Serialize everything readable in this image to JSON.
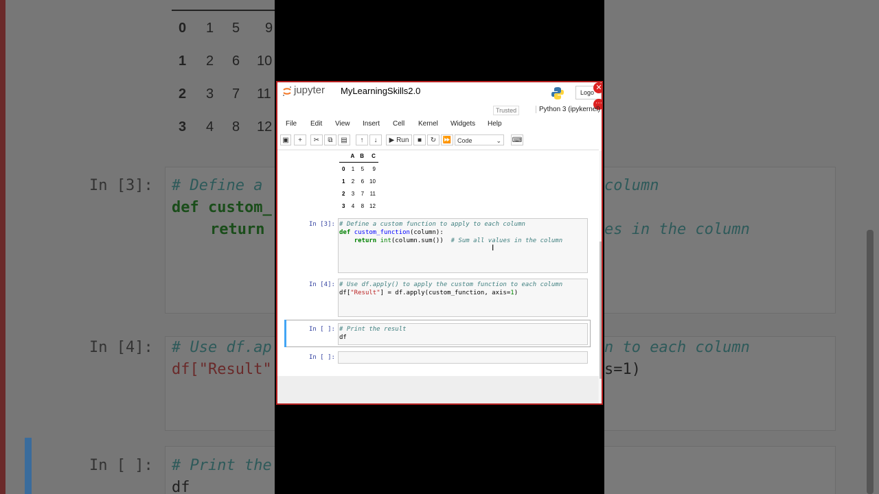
{
  "background": {
    "table_rows": [
      [
        "0",
        "1",
        "5",
        "9"
      ],
      [
        "1",
        "2",
        "6",
        "10"
      ],
      [
        "2",
        "3",
        "7",
        "11"
      ],
      [
        "3",
        "4",
        "8",
        "12"
      ]
    ],
    "cell3_prompt": "In [3]:",
    "cell3_line1": "# Define a",
    "cell3_line1_right": "column",
    "cell3_line2": "def custom_",
    "cell3_line3": "return",
    "cell3_line3_right": "es in the column",
    "cell4_prompt": "In [4]:",
    "cell4_line1": "# Use df.ap",
    "cell4_line1_right": "n to each column",
    "cell4_line2": "df[\"Result\"",
    "cell4_line2_right": "s=1)",
    "cell5_prompt": "In [ ]:",
    "cell5_line1": "# Print the",
    "cell5_line2": "df"
  },
  "header": {
    "logo_text": "jupyter",
    "notebook_name": "MyLearningSkills2.0",
    "logout_label": "Logo",
    "trusted": "Trusted",
    "kernel": "Python 3 (ipykernel)"
  },
  "menu": [
    "File",
    "Edit",
    "View",
    "Insert",
    "Cell",
    "Kernel",
    "Widgets",
    "Help"
  ],
  "toolbar": {
    "run_label": "Run",
    "cell_type": "Code"
  },
  "dataframe": {
    "columns": [
      "A",
      "B",
      "C"
    ],
    "rows": [
      {
        "index": "0",
        "values": [
          "1",
          "5",
          "9"
        ]
      },
      {
        "index": "1",
        "values": [
          "2",
          "6",
          "10"
        ]
      },
      {
        "index": "2",
        "values": [
          "3",
          "7",
          "11"
        ]
      },
      {
        "index": "3",
        "values": [
          "4",
          "8",
          "12"
        ]
      }
    ]
  },
  "cells": {
    "c3": {
      "prompt": "In [3]:",
      "line1": "# Define a custom function to apply to each column",
      "line2_kw": "def",
      "line2_fn": "custom_function",
      "line2_rest": "(column):",
      "line3_kw": "return",
      "line3_bi": "int",
      "line3_rest": "(column.sum())",
      "line3_cm": "# Sum all values in the column"
    },
    "c4": {
      "prompt": "In [4]:",
      "line1": "# Use df.apply() to apply the custom function to each column",
      "line2_a": "df[",
      "line2_str": "\"Result\"",
      "line2_b": "] = df.apply(custom_function, axis=",
      "line2_num": "1",
      "line2_c": ")"
    },
    "c5": {
      "prompt": "In [ ]:",
      "line1": "# Print the result",
      "line2": "df"
    },
    "c6": {
      "prompt": "In [ ]:"
    }
  }
}
